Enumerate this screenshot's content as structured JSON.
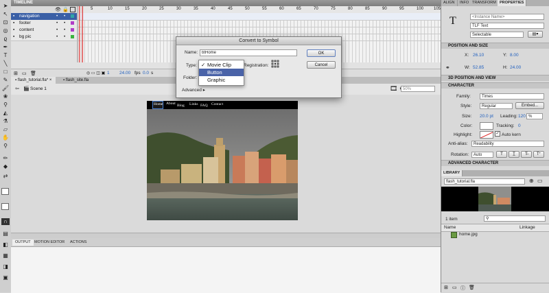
{
  "timeline": {
    "title": "TIMELINE",
    "layers": [
      {
        "name": "navigation",
        "selected": true,
        "color": "#2fa6a6"
      },
      {
        "name": "footer",
        "selected": false,
        "color": "#b13cc7"
      },
      {
        "name": "content",
        "selected": false,
        "color": "#b13cc7"
      },
      {
        "name": "bg pic",
        "selected": false,
        "color": "#39b43d"
      }
    ],
    "frame_numbers": [
      "5",
      "10",
      "15",
      "20",
      "25",
      "30",
      "35",
      "40",
      "45",
      "50",
      "55",
      "60",
      "65",
      "70",
      "75",
      "80",
      "85",
      "90",
      "95",
      "100",
      "105"
    ],
    "fps": "24.00",
    "fps_unit": "fps",
    "time": "0.0",
    "time_unit": "s",
    "current_frame": "1"
  },
  "documents": {
    "tabs": [
      "flash_tutorial.fla*",
      "flash_site.fla"
    ],
    "scene": "Scene 1",
    "zoom": "50%"
  },
  "stage": {
    "nav_links": [
      "Home",
      "About",
      "Blog",
      "Links",
      "FAQ",
      "Contact"
    ]
  },
  "bottom_tabs": [
    "OUTPUT",
    "MOTION EDITOR",
    "ACTIONS"
  ],
  "dialog": {
    "title": "Convert to Symbol",
    "name_label": "Name:",
    "name_value": "btHome",
    "type_label": "Type:",
    "registration_label": "Registration:",
    "folder_label": "Folder:",
    "advanced_label": "Advanced",
    "ok_label": "OK",
    "cancel_label": "Cancel",
    "type_options": [
      "Movie Clip",
      "Button",
      "Graphic"
    ],
    "checked_option": "Movie Clip",
    "highlighted_option": "Button"
  },
  "right_tabs": [
    "ALIGN",
    "INFO",
    "TRANSFORM",
    "PROPERTIES"
  ],
  "properties": {
    "instance_name_placeholder": "<Instance Name>",
    "text_engine": "TLF Text",
    "selectability": "Selectable",
    "position_section": "POSITION AND SIZE",
    "x_label": "X:",
    "x_value": "26.10",
    "y_label": "Y:",
    "y_value": "8.00",
    "w_label": "W:",
    "w_value": "52.85",
    "h_label": "H:",
    "h_value": "24.00",
    "threed_section": "3D POSITION AND VIEW",
    "character_section": "CHARACTER",
    "family_label": "Family:",
    "family_value": "Times",
    "style_label": "Style:",
    "style_value": "Regular",
    "embed_label": "Embed...",
    "size_label": "Size:",
    "size_value": "20.0 pt",
    "leading_label": "Leading:",
    "leading_value": "120",
    "leading_unit": "%",
    "color_label": "Color:",
    "tracking_label": "Tracking:",
    "tracking_value": "0",
    "highlight_label": "Highlight:",
    "auto_kern_label": "Auto kern",
    "antialias_label": "Anti-alias:",
    "antialias_value": "Readability",
    "rotation_label": "Rotation:",
    "rotation_value": "Auto",
    "advanced_char_section": "ADVANCED CHARACTER"
  },
  "library": {
    "title": "LIBRARY",
    "file": "flash_tutorial.fla",
    "count": "1 item",
    "name_col": "Name",
    "linkage_col": "Linkage",
    "items": [
      "home.jpg"
    ]
  }
}
